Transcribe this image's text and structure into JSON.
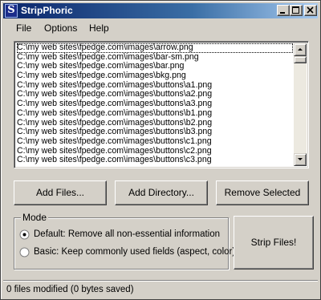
{
  "window": {
    "title": "StripPhoric",
    "app_icon_letter": "S"
  },
  "menu": {
    "file": "File",
    "options": "Options",
    "help": "Help"
  },
  "file_list": [
    "C:\\my web sites\\fpedge.com\\images\\arrow.png",
    "C:\\my web sites\\fpedge.com\\images\\bar-sm.png",
    "C:\\my web sites\\fpedge.com\\images\\bar.png",
    "C:\\my web sites\\fpedge.com\\images\\bkg.png",
    "C:\\my web sites\\fpedge.com\\images\\buttons\\a1.png",
    "C:\\my web sites\\fpedge.com\\images\\buttons\\a2.png",
    "C:\\my web sites\\fpedge.com\\images\\buttons\\a3.png",
    "C:\\my web sites\\fpedge.com\\images\\buttons\\b1.png",
    "C:\\my web sites\\fpedge.com\\images\\buttons\\b2.png",
    "C:\\my web sites\\fpedge.com\\images\\buttons\\b3.png",
    "C:\\my web sites\\fpedge.com\\images\\buttons\\c1.png",
    "C:\\my web sites\\fpedge.com\\images\\buttons\\c2.png",
    "C:\\my web sites\\fpedge.com\\images\\buttons\\c3.png"
  ],
  "buttons": {
    "add_files": "Add Files...",
    "add_directory": "Add Directory...",
    "remove_selected": "Remove Selected",
    "strip_files": "Strip Files!"
  },
  "mode": {
    "label": "Mode",
    "options": [
      {
        "label": "Default: Remove all non-essential information",
        "selected": true
      },
      {
        "label": "Basic: Keep commonly used fields (aspect, color)",
        "selected": false
      }
    ]
  },
  "status": {
    "text": "0 files modified (0 bytes saved)"
  }
}
